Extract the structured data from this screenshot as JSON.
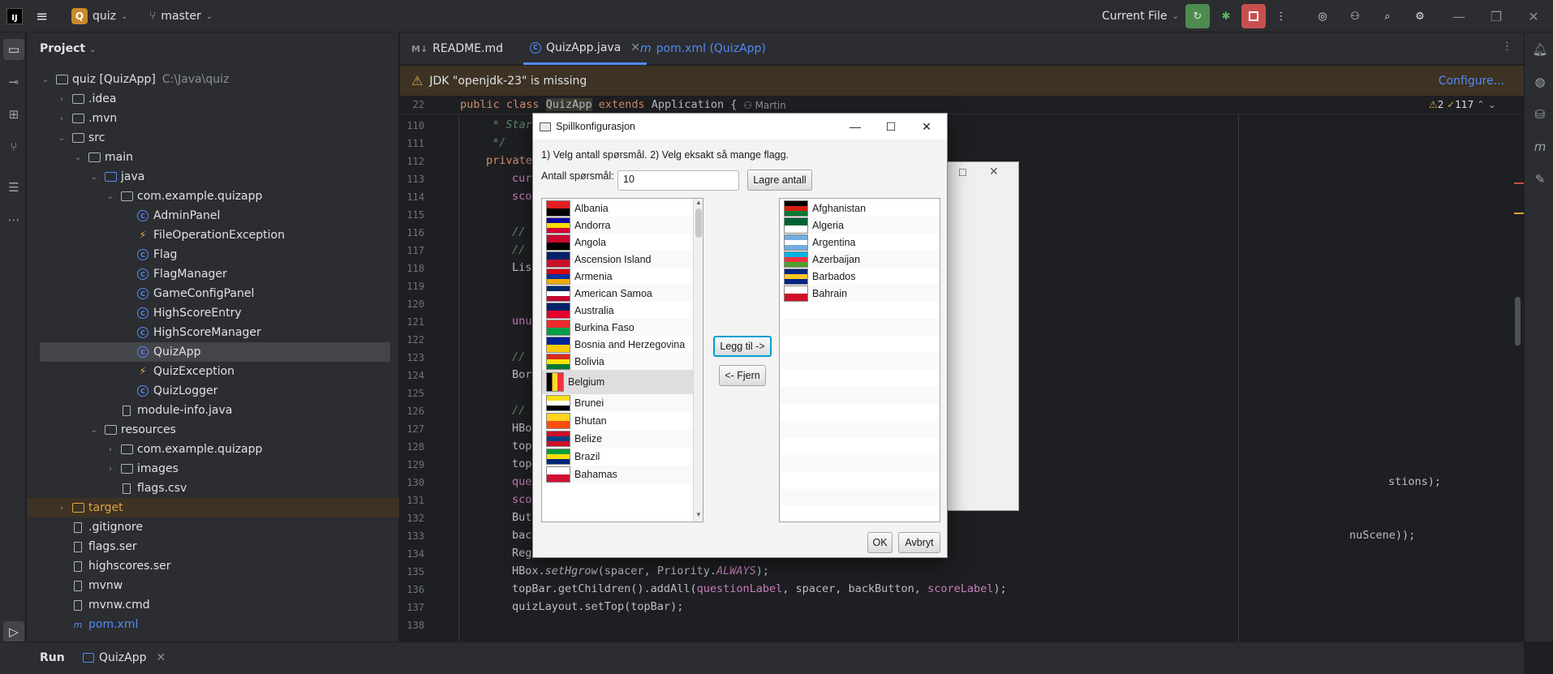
{
  "titlebar": {
    "project_letter": "Q",
    "project_name": "quiz",
    "branch": "master",
    "run_config": "Current File"
  },
  "project_panel": {
    "title": "Project",
    "tree": [
      {
        "label": "quiz [QuizApp]",
        "hint": "C:\\Java\\quiz",
        "depth": 0,
        "kind": "folder",
        "open": true
      },
      {
        "label": ".idea",
        "depth": 1,
        "kind": "folder"
      },
      {
        "label": ".mvn",
        "depth": 1,
        "kind": "folder"
      },
      {
        "label": "src",
        "depth": 1,
        "kind": "folder",
        "open": true
      },
      {
        "label": "main",
        "depth": 2,
        "kind": "folder",
        "open": true
      },
      {
        "label": "java",
        "depth": 3,
        "kind": "folder-blue",
        "open": true
      },
      {
        "label": "com.example.quizapp",
        "depth": 4,
        "kind": "package",
        "open": true
      },
      {
        "label": "AdminPanel",
        "depth": 5,
        "kind": "class"
      },
      {
        "label": "FileOperationException",
        "depth": 5,
        "kind": "exception"
      },
      {
        "label": "Flag",
        "depth": 5,
        "kind": "class"
      },
      {
        "label": "FlagManager",
        "depth": 5,
        "kind": "class"
      },
      {
        "label": "GameConfigPanel",
        "depth": 5,
        "kind": "class"
      },
      {
        "label": "HighScoreEntry",
        "depth": 5,
        "kind": "class"
      },
      {
        "label": "HighScoreManager",
        "depth": 5,
        "kind": "class"
      },
      {
        "label": "QuizApp",
        "depth": 5,
        "kind": "class",
        "selected": true
      },
      {
        "label": "QuizException",
        "depth": 5,
        "kind": "exception"
      },
      {
        "label": "QuizLogger",
        "depth": 5,
        "kind": "class"
      },
      {
        "label": "module-info.java",
        "depth": 4,
        "kind": "file"
      },
      {
        "label": "resources",
        "depth": 3,
        "kind": "folder",
        "open": true
      },
      {
        "label": "com.example.quizapp",
        "depth": 4,
        "kind": "folder"
      },
      {
        "label": "images",
        "depth": 4,
        "kind": "folder"
      },
      {
        "label": "flags.csv",
        "depth": 4,
        "kind": "file"
      },
      {
        "label": "target",
        "depth": 1,
        "kind": "folder-target"
      },
      {
        "label": ".gitignore",
        "depth": 1,
        "kind": "file"
      },
      {
        "label": "flags.ser",
        "depth": 1,
        "kind": "file"
      },
      {
        "label": "highscores.ser",
        "depth": 1,
        "kind": "file"
      },
      {
        "label": "mvnw",
        "depth": 1,
        "kind": "file"
      },
      {
        "label": "mvnw.cmd",
        "depth": 1,
        "kind": "file"
      },
      {
        "label": "pom.xml",
        "depth": 1,
        "kind": "maven"
      }
    ]
  },
  "tabs": [
    {
      "label": "README.md",
      "icon": "markdown-icon"
    },
    {
      "label": "QuizApp.java",
      "icon": "class-icon",
      "active": true
    },
    {
      "label": "pom.xml (QuizApp)",
      "icon": "maven-icon"
    }
  ],
  "banner": {
    "message": "JDK \"openjdk-23\" is missing",
    "action": "Configure..."
  },
  "editor": {
    "sticky_line": "22",
    "author": "Martin",
    "warnings": "2",
    "weak_warnings": "117",
    "line_numbers": [
      "110",
      "111",
      "112",
      "113",
      "114",
      "115",
      "116",
      "117",
      "118",
      "119",
      "120",
      "121",
      "122",
      "123",
      "124",
      "125",
      "126",
      "127",
      "128",
      "129",
      "130",
      "131",
      "132",
      "133",
      "134",
      "135",
      "136",
      "137",
      "138"
    ],
    "lines": {
      "l110": "* Star",
      "l111": "*/",
      "l112": "private",
      "l113": "cur",
      "l114": "sco",
      "l116": "//",
      "l117": "//",
      "l118": "Lis",
      "l121": "unu",
      "l123": "//",
      "l124": "Bor",
      "l126": "//",
      "l127": "HBo",
      "l128": "top",
      "l129": "top",
      "l130a": "que",
      "l130b": "stions);",
      "l131": "sco",
      "l132": "But",
      "l133a": "bac",
      "l133b": "nuScene));",
      "l134": "Reg",
      "l135a": "HBox.",
      "l135b": "setHgrow",
      "l135c": "(spacer, Priority.",
      "l135d": "ALWAYS",
      "l135e": ");",
      "l136a": "topBar.getChildren().addAll(",
      "l136b": "questionLabel",
      "l136c": ", spacer, backButton, ",
      "l136d": "scoreLabel",
      "l136e": ");",
      "l137": "quizLayout.setTop(topBar);"
    }
  },
  "bottombar": {
    "run_label": "Run",
    "run_tab": "QuizApp"
  },
  "dialog": {
    "title": "Spillkonfigurasjon",
    "instructions": "1) Velg antall spørsmål. 2) Velg eksakt så mange flagg.",
    "count_label": "Antall spørsmål:",
    "count_value": "10",
    "save_count_button": "Lagre antall",
    "add_button": "Legg til ->",
    "remove_button": "<- Fjern",
    "ok_button": "OK",
    "cancel_button": "Avbryt",
    "available": [
      {
        "name": "Albania",
        "colors": [
          "#e41e20",
          "#000000"
        ]
      },
      {
        "name": "Andorra",
        "colors": [
          "#10069f",
          "#fedd00",
          "#d50032"
        ]
      },
      {
        "name": "Angola",
        "colors": [
          "#cc092f",
          "#000000"
        ]
      },
      {
        "name": "Ascension Island",
        "colors": [
          "#012169",
          "#c8102e"
        ]
      },
      {
        "name": "Armenia",
        "colors": [
          "#d90012",
          "#0033a0",
          "#f2a800"
        ]
      },
      {
        "name": "American Samoa",
        "colors": [
          "#002868",
          "#ffffff",
          "#bf0a30"
        ]
      },
      {
        "name": "Australia",
        "colors": [
          "#012169",
          "#e4002b"
        ]
      },
      {
        "name": "Burkina Faso",
        "colors": [
          "#ef2b2d",
          "#009e49"
        ]
      },
      {
        "name": "Bosnia and Herzegovina",
        "colors": [
          "#002395",
          "#fecb00"
        ]
      },
      {
        "name": "Bolivia",
        "colors": [
          "#d52b1e",
          "#f9e300",
          "#007934"
        ]
      },
      {
        "name": "Belgium",
        "colors": [
          "#000000",
          "#fdda24",
          "#ef3340"
        ],
        "selected": true
      },
      {
        "name": "Brunei",
        "colors": [
          "#f7e017",
          "#ffffff",
          "#000000"
        ]
      },
      {
        "name": "Bhutan",
        "colors": [
          "#ffd520",
          "#ff4e12"
        ]
      },
      {
        "name": "Belize",
        "colors": [
          "#ce1126",
          "#003f87",
          "#ce1126"
        ]
      },
      {
        "name": "Brazil",
        "colors": [
          "#009c3b",
          "#ffdf00",
          "#002776"
        ]
      },
      {
        "name": "Bahamas",
        "colors": [
          "#ffffff",
          "#d21034"
        ]
      }
    ],
    "chosen": [
      {
        "name": "Afghanistan",
        "colors": [
          "#000000",
          "#d32011",
          "#007a36"
        ]
      },
      {
        "name": "Algeria",
        "colors": [
          "#006233",
          "#ffffff"
        ]
      },
      {
        "name": "Argentina",
        "colors": [
          "#74acdf",
          "#ffffff",
          "#74acdf"
        ]
      },
      {
        "name": "Azerbaijan",
        "colors": [
          "#00b5e2",
          "#ef3340",
          "#509e2f"
        ]
      },
      {
        "name": "Barbados",
        "colors": [
          "#00267f",
          "#ffc726",
          "#00267f"
        ]
      },
      {
        "name": "Bahrain",
        "colors": [
          "#ffffff",
          "#ce1126"
        ]
      }
    ]
  }
}
